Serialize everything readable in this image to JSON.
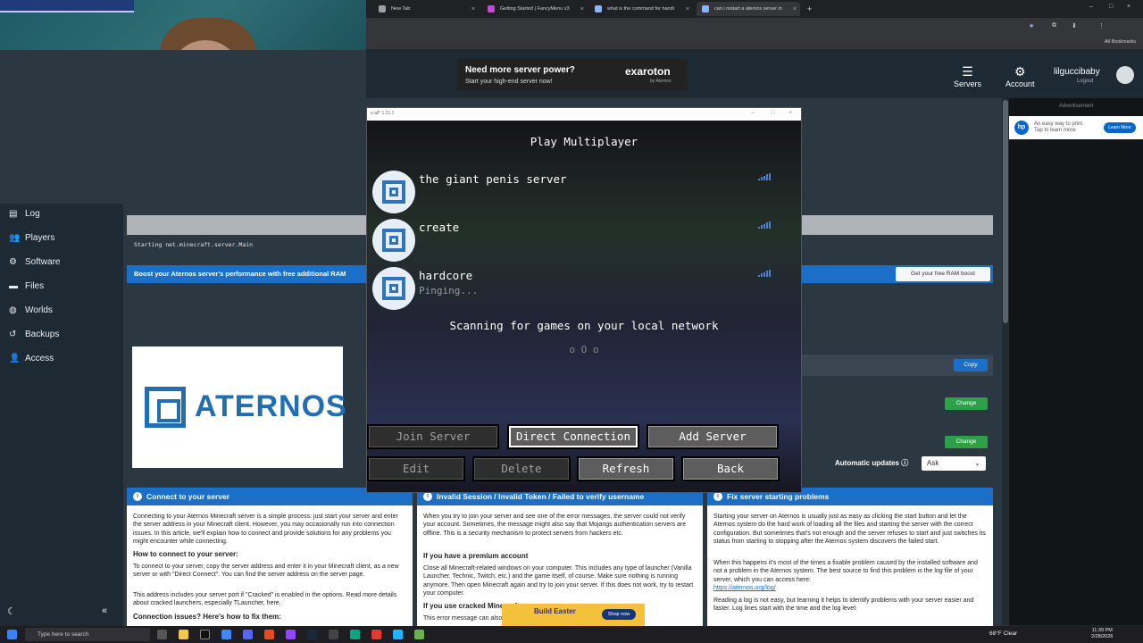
{
  "browser": {
    "tabs": [
      {
        "title": "New Tab"
      },
      {
        "title": "Getting Started | FancyMenu v3"
      },
      {
        "title": "what is the command for handi"
      },
      {
        "title": "can i restart a aternos server in"
      }
    ],
    "all_bookmarks": "All Bookmarks"
  },
  "ad_banner": {
    "headline": "Need more server power?",
    "subline": "Start your high-end server now!",
    "brand": "exaroton",
    "brand_sub": "by Aternos"
  },
  "topnav": {
    "servers": "Servers",
    "account": "Account",
    "username": "lilguccibaby",
    "logout": "Logout"
  },
  "right_ad": {
    "label": "Advertisement",
    "text_line1": "An easy way to print.",
    "text_line2": "Tap to learn more",
    "button": "Learn More",
    "logo": "hp"
  },
  "sidebar": {
    "items": [
      {
        "label": "Log",
        "icon": "log-icon"
      },
      {
        "label": "Players",
        "icon": "players-icon"
      },
      {
        "label": "Software",
        "icon": "software-icon"
      },
      {
        "label": "Files",
        "icon": "files-icon"
      },
      {
        "label": "Worlds",
        "icon": "worlds-icon"
      },
      {
        "label": "Backups",
        "icon": "backups-icon"
      },
      {
        "label": "Access",
        "icon": "access-icon"
      }
    ]
  },
  "console": {
    "line": "Starting net.minecraft.server.Main"
  },
  "boost": {
    "text": "Boost your Aternos server's performance with free additional RAM",
    "button": "Get your free RAM boost"
  },
  "logo_text": "ATERNOS",
  "server_panel": {
    "copy": "Copy",
    "change1": "Change",
    "change2": "Change",
    "auto_updates": "Automatic updates",
    "auto_updates_value": "Ask"
  },
  "cards": [
    {
      "title": "Connect to your server",
      "p1": "Connecting to your Aternos Minecraft server is a simple process: just start your server and enter the server address in your Minecraft client. However, you may occasionally run into connection issues. In this article, we'll explain how to connect and provide solutions for any problems you might encounter while connecting.",
      "h2": "How to connect to your server:",
      "p2": "To connect to your server, copy the server address and enter it in your Minecraft client, as a new server or with \"Direct Connect\". You can find the server address on the server page.",
      "p3": "This address includes your server port if \"Cracked\" is enabled in the options. Read more details about cracked launchers, especially TLauncher, here.",
      "h3": "Connection issues? Here's how to fix them:"
    },
    {
      "title": "Invalid Session / Invalid Token / Failed to verify username",
      "p1": "When you try to join your server and see one of the error messages, the server could not verify your account. Sometimes, the message might also say that Mojangs authentication servers are offline. This is a security mechanism to protect servers from hackers etc.",
      "h2": "If you have a premium account",
      "p2": "Close all Minecraft-related windows on your computer. This includes any type of launcher (Vanilla Launcher, Technic, Twitch, etc.) and the game itself, of course. Make sure nothing is running anymore. Then open Minecraft again and try to join your server. If this does not work, try to restart your computer.",
      "h3": "If you use cracked Minecraft",
      "p3": "This error message can also appear if you are using a cracked"
    },
    {
      "title": "Fix server starting problems",
      "p1": "Starting your server on Aternos is usually just as easy as clicking the start button and let the Aternos system do the hard work of loading all the files and starting the server with the correct configuration. But sometimes that's not enough and the server refuses to start and just switches its status from starting to stopping after the Aternos system discovers the failed start.",
      "p2": "When this happens it's most of the times a fixable problem caused by the installed software and not a problem in the Aternos system. The best source to find this problem is the log file of your server, which you can access here:",
      "link": "https://aternos.org/log/",
      "p3": "Reading a log is not easy, but learning it helps to identify problems with your server easier and faster. Log lines start with the time and the log level:"
    }
  ],
  "minecraft": {
    "window_title": "e.all* 1.21.1",
    "title": "Play Multiplayer",
    "servers": [
      {
        "name": "the giant penis server",
        "status": ""
      },
      {
        "name": "create",
        "status": ""
      },
      {
        "name": "hardcore",
        "status": "Pinging..."
      }
    ],
    "scanning": "Scanning for games on your local network",
    "dots": "o O o",
    "buttons": {
      "join": "Join Server",
      "direct": "Direct Connection",
      "add": "Add Server",
      "edit": "Edit",
      "delete": "Delete",
      "refresh": "Refresh",
      "back": "Back"
    }
  },
  "taskbar": {
    "search_placeholder": "Type here to search",
    "weather": "68°F Clear",
    "time": "11:39 PM",
    "date": "2/28/2026"
  },
  "easter_ad": {
    "brand": "Build Easter",
    "cta": "Shop now"
  }
}
